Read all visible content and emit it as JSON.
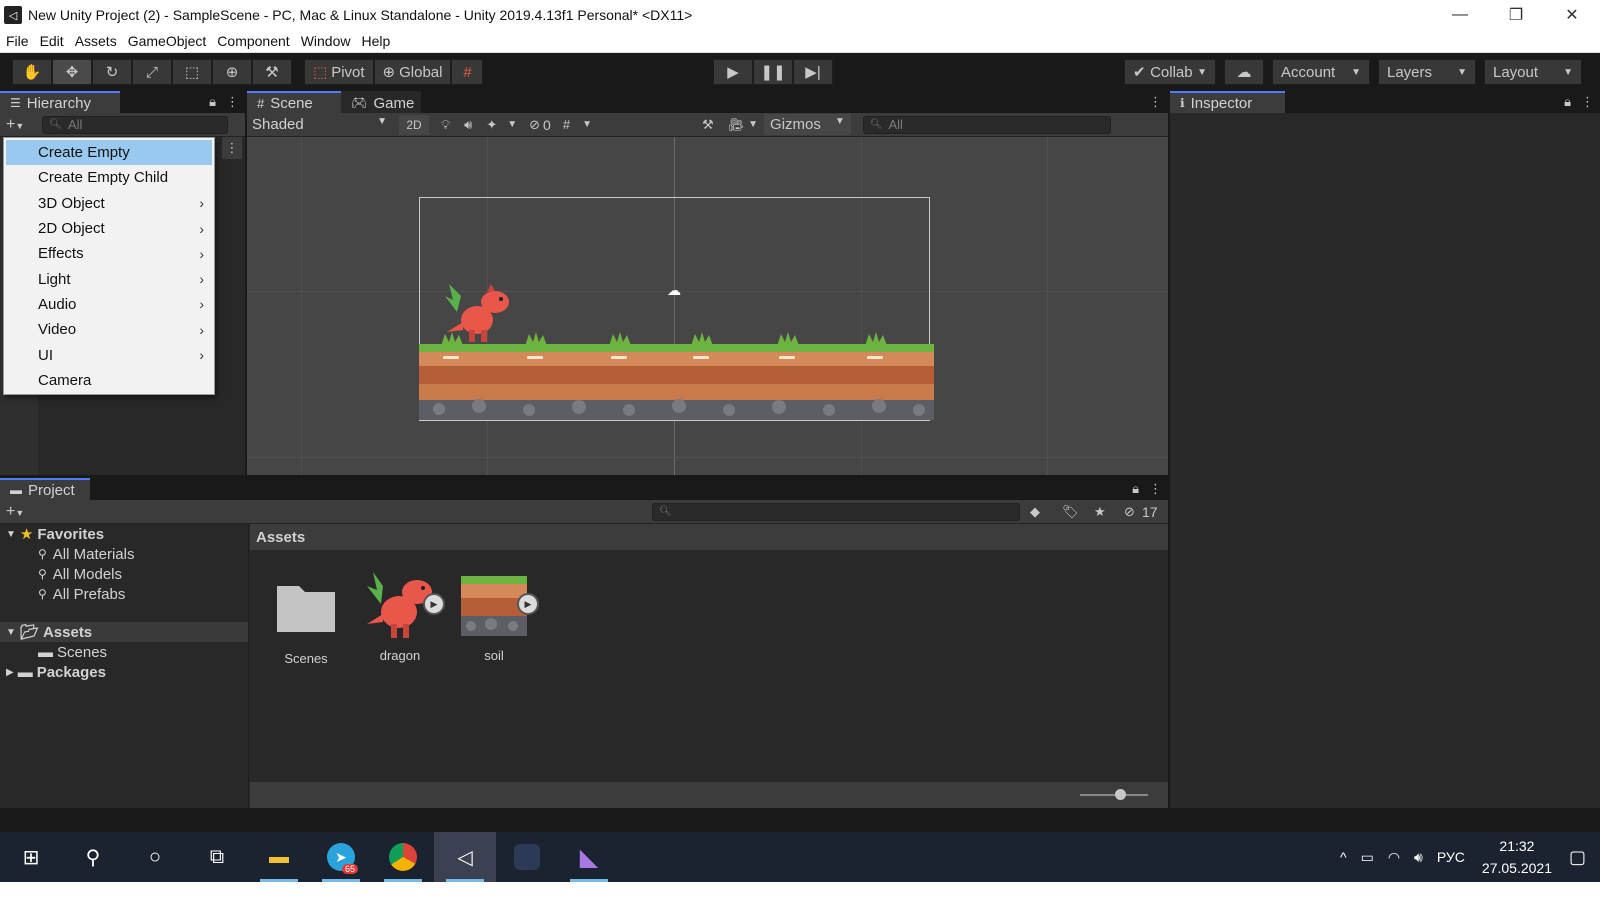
{
  "window": {
    "title": "New Unity Project (2) - SampleScene - PC, Mac & Linux Standalone - Unity 2019.4.13f1 Personal* <DX11>",
    "minimize": "—",
    "maximize": "❐",
    "close": "✕"
  },
  "menubar": [
    "File",
    "Edit",
    "Assets",
    "GameObject",
    "Component",
    "Window",
    "Help"
  ],
  "toolbar": {
    "pivot_label": "Pivot",
    "global_label": "Global",
    "collab_label": "Collab",
    "account_label": "Account",
    "layers_label": "Layers",
    "layout_label": "Layout"
  },
  "hierarchy": {
    "tab_label": "Hierarchy",
    "search_placeholder": "All"
  },
  "context_menu": {
    "items": [
      {
        "label": "Create Empty",
        "submenu": false,
        "selected": true
      },
      {
        "label": "Create Empty Child",
        "submenu": false
      },
      {
        "label": "3D Object",
        "submenu": true
      },
      {
        "label": "2D Object",
        "submenu": true
      },
      {
        "label": "Effects",
        "submenu": true
      },
      {
        "label": "Light",
        "submenu": true
      },
      {
        "label": "Audio",
        "submenu": true
      },
      {
        "label": "Video",
        "submenu": true
      },
      {
        "label": "UI",
        "submenu": true
      },
      {
        "label": "Camera",
        "submenu": false
      }
    ]
  },
  "scene": {
    "tab_scene": "Scene",
    "tab_game": "Game",
    "shading_mode": "Shaded",
    "mode_2d": "2D",
    "hidden_count": "0",
    "gizmos_label": "Gizmos",
    "search_placeholder": "All"
  },
  "inspector": {
    "tab_label": "Inspector"
  },
  "project": {
    "tab_label": "Project",
    "hidden_count": "17",
    "favorites_label": "Favorites",
    "favorites": [
      "All Materials",
      "All Models",
      "All Prefabs"
    ],
    "assets_label": "Assets",
    "assets_children": [
      "Scenes"
    ],
    "packages_label": "Packages",
    "breadcrumb": "Assets",
    "assets": [
      {
        "name": "Scenes",
        "kind": "folder"
      },
      {
        "name": "dragon",
        "kind": "sprite"
      },
      {
        "name": "soil",
        "kind": "sprite"
      }
    ],
    "zoom_level": 0.55
  },
  "taskbar": {
    "telegram_badge": "65",
    "language": "РУС",
    "time": "21:32",
    "date": "27.05.2021"
  },
  "colors": {
    "accent": "#4c7eff",
    "menu_highlight": "#99c9ef",
    "grass": "#6cb43f",
    "soil": "#c97a4a",
    "dragon": "#e8574a"
  }
}
